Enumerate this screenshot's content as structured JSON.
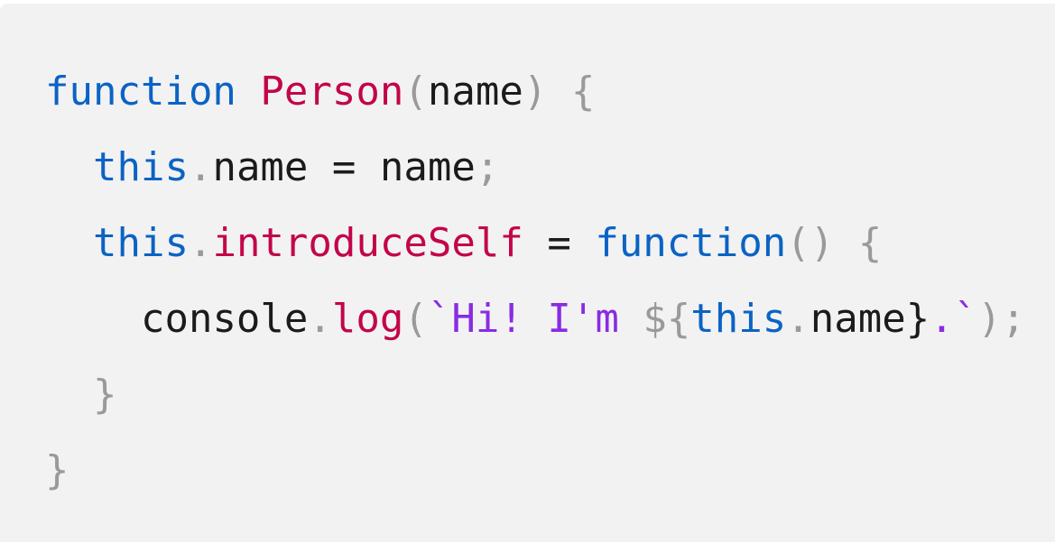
{
  "code": {
    "language": "javascript",
    "colors": {
      "background": "#f2f2f2",
      "keyword": "#0b63c4",
      "function_name": "#c3044a",
      "string": "#8a2be2",
      "punctuation": "#9a9a9a",
      "text": "#1b1b1b"
    },
    "lines": [
      "function Person(name) {",
      "  this.name = name;",
      "  this.introduceSelf = function() {",
      "    console.log(`Hi! I'm ${this.name}.`);",
      "  }",
      "}"
    ],
    "tokens": {
      "l1": [
        "function",
        " ",
        "Person",
        "(",
        "name",
        ")",
        " ",
        "{"
      ],
      "l2": [
        "  ",
        "this",
        ".",
        "name",
        " = ",
        "name",
        ";"
      ],
      "l3": [
        "  ",
        "this",
        ".",
        "introduceSelf",
        " = ",
        "function",
        "()",
        " ",
        "{"
      ],
      "l4": [
        "    ",
        "console",
        ".",
        "log",
        "(",
        "`Hi! I'm ",
        "${",
        "this",
        ".",
        "name",
        "}",
        ".`",
        ");"
      ],
      "l5": [
        "  ",
        "}"
      ],
      "l6": [
        "}"
      ]
    }
  }
}
